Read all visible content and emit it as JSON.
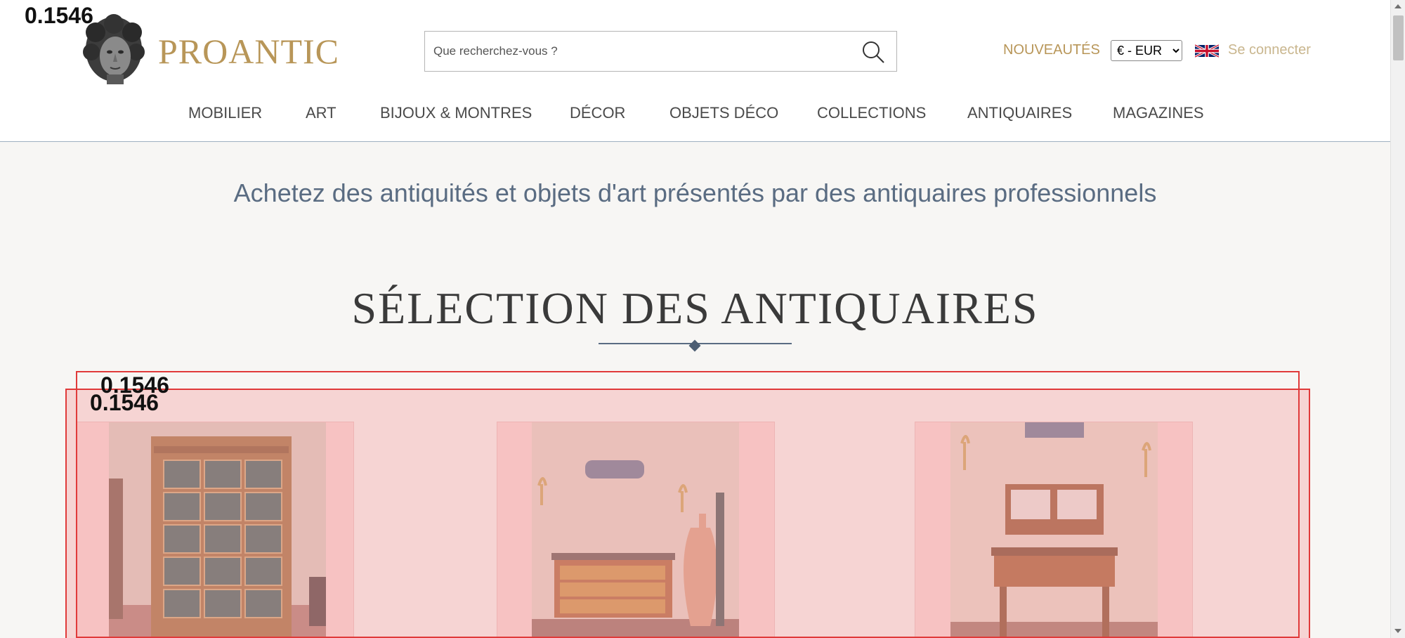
{
  "brand": {
    "logo_text": "PROANTIC",
    "color": "#b89658"
  },
  "search": {
    "placeholder": "Que recherchez-vous ?"
  },
  "header": {
    "nouveautes": "NOUVEAUTÉS",
    "currency_selected": "€ - EUR",
    "connect": "Se connecter"
  },
  "nav": {
    "items": [
      "MOBILIER",
      "ART",
      "BIJOUX & MONTRES",
      "DÉCOR",
      "OBJETS DÉCO",
      "COLLECTIONS",
      "ANTIQUAIRES",
      "MAGAZINES"
    ]
  },
  "tagline": "Achetez des antiquités et objets d'art présentés par des antiquaires professionnels",
  "section": {
    "title": "SÉLECTION DES ANTIQUAIRES"
  },
  "overlay": {
    "score_logo": "0.1546",
    "score_grid": "0.1546",
    "score_grid_2": "0.1546"
  },
  "colors": {
    "accent": "#b89658",
    "tagline": "#5a6c82",
    "highlight": "#e03a3a"
  }
}
